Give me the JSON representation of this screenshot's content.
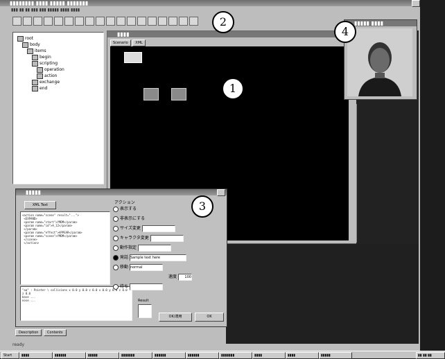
{
  "app": {
    "title": "▮▮▮▮▮▮▮▮ ▮▮▮▮ ▮▮▮▮▮ ▮▮▮▮▮▮▮",
    "menu": "▮▮▮ ▮▮ ▮▮ ▮▮▮ ▮▮▮ ▮▮▮▮▮ ▮▮▮▮ ▮▮▮▮"
  },
  "callouts": {
    "one": "1",
    "two": "2",
    "three": "3",
    "four": "4"
  },
  "tree": {
    "items": [
      {
        "label": "root",
        "level": 0
      },
      {
        "label": "body",
        "level": 1
      },
      {
        "label": "items",
        "level": 2
      },
      {
        "label": "begin",
        "level": 3
      },
      {
        "label": "scripting",
        "level": 3
      },
      {
        "label": "operation",
        "level": 4
      },
      {
        "label": "action",
        "level": 4
      },
      {
        "label": "exchange",
        "level": 3
      },
      {
        "label": "end",
        "level": 3
      }
    ]
  },
  "editor": {
    "title": "▮▮▮▮",
    "tabs": [
      "Scenario",
      "XML"
    ]
  },
  "camera": {
    "title": "▮▮▮▮▮ ▮▮▮▮"
  },
  "dialog": {
    "title": "▮▮▮▮▮",
    "xml_button": "XML Text",
    "script_text": "<action name=\"scene\" result=\"...\">\n <EXPAND>\n <param name=\"start\">YMDM</param>\n <param name=\"id\">A_12</param>\n </param>\n <param name=\"effect\">APPEAR</param>\n <param name=\"scene\">YMDM</param>\n </scene>\n </action>",
    "log_text": "\"aa\" : Pointer \\ collisions x 0.0 y 0.0 z 0.0 x 0.0 y 0.0 z 0.0 z 0.0\nbase ...\nnose ...",
    "action_label": "アクション",
    "radios": [
      "表示する",
      "非表示にする",
      "サイズ変更",
      "キャラクタ変更",
      "動作指定",
      "発話",
      "移動",
      "待ち"
    ],
    "utterance_value": "Sample text here",
    "motion_value": "normal",
    "speed_label": "速度",
    "speed_value": "100",
    "small_label": "Result",
    "apply_button": "OK/適用",
    "ok_button": "OK",
    "tabs": [
      "Description",
      "Contents"
    ]
  },
  "statusbar": {
    "text": "ready"
  },
  "taskbar": {
    "start": "Start",
    "items": [
      "▮▮▮▮",
      "▮▮▮▮▮▮",
      "▮▮▮▮▮",
      "▮▮▮▮▮▮▮",
      "▮▮▮▮▮▮",
      "▮▮▮▮▮▮",
      "▮▮▮▮▮▮▮",
      "▮▮▮▮",
      "▮▮▮▮",
      "▮▮▮▮▮"
    ],
    "clock": "▮▮ ▮▮:▮▮"
  }
}
